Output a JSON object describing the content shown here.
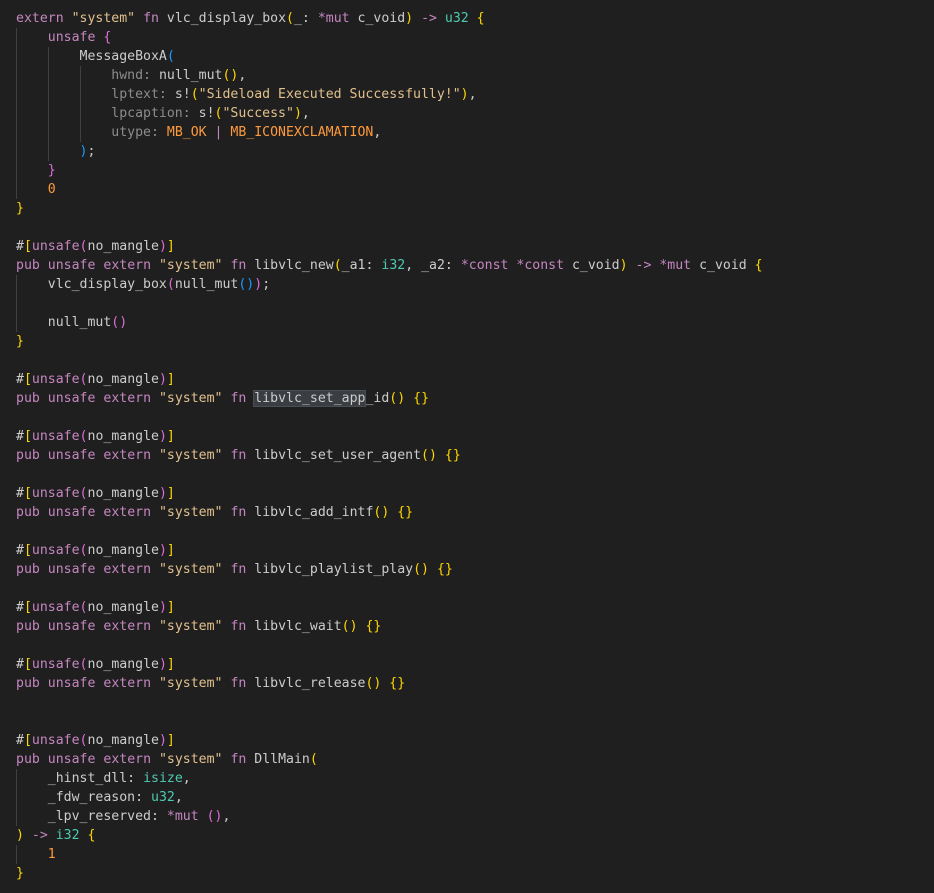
{
  "palette": {
    "background": "#1f1f1f",
    "keyword": "#c586c0",
    "keyword_blue": "#569cd6",
    "string": "#ce9178",
    "string_bright": "#e2c08d",
    "function": "#dcdcaa",
    "type": "#4ec9b0",
    "number": "#b5cea8",
    "plain": "#cccccc",
    "param_hint": "#8c8c8c",
    "bracket_gold": "#ffd700",
    "bracket_pink": "#da70d6",
    "bracket_blue": "#179fff",
    "constant": "#ff9a3c",
    "operator": "#d4d4d4"
  },
  "code_lines": [
    {
      "indent": 0,
      "tokens": [
        {
          "t": "extern",
          "c": "keyword"
        },
        {
          "t": " "
        },
        {
          "t": "\"system\"",
          "c": "string_bright"
        },
        {
          "t": " "
        },
        {
          "t": "fn",
          "c": "keyword"
        },
        {
          "t": " "
        },
        {
          "t": "vlc_display_box",
          "c": "plain"
        },
        {
          "t": "(",
          "c": "bracket_gold"
        },
        {
          "t": "_",
          "c": "plain"
        },
        {
          "t": ": ",
          "c": "plain"
        },
        {
          "t": "*mut",
          "c": "keyword"
        },
        {
          "t": " "
        },
        {
          "t": "c_void",
          "c": "plain"
        },
        {
          "t": ")",
          "c": "bracket_gold"
        },
        {
          "t": " -> ",
          "c": "keyword"
        },
        {
          "t": "u32",
          "c": "type"
        },
        {
          "t": " "
        },
        {
          "t": "{",
          "c": "bracket_gold"
        }
      ]
    },
    {
      "indent": 1,
      "tokens": [
        {
          "t": "unsafe",
          "c": "keyword"
        },
        {
          "t": " "
        },
        {
          "t": "{",
          "c": "bracket_pink"
        }
      ]
    },
    {
      "indent": 2,
      "tokens": [
        {
          "t": "MessageBoxA",
          "c": "plain"
        },
        {
          "t": "(",
          "c": "bracket_blue"
        }
      ]
    },
    {
      "indent": 3,
      "tokens": [
        {
          "t": "hwnd:",
          "c": "param_hint"
        },
        {
          "t": " "
        },
        {
          "t": "null_mut",
          "c": "plain"
        },
        {
          "t": "()",
          "c": "bracket_gold"
        },
        {
          "t": ",",
          "c": "plain"
        }
      ]
    },
    {
      "indent": 3,
      "tokens": [
        {
          "t": "lptext:",
          "c": "param_hint"
        },
        {
          "t": " "
        },
        {
          "t": "s!",
          "c": "plain"
        },
        {
          "t": "(",
          "c": "bracket_gold"
        },
        {
          "t": "\"Sideload Executed Successfully!\"",
          "c": "string_bright"
        },
        {
          "t": ")",
          "c": "bracket_gold"
        },
        {
          "t": ",",
          "c": "plain"
        }
      ]
    },
    {
      "indent": 3,
      "tokens": [
        {
          "t": "lpcaption:",
          "c": "param_hint"
        },
        {
          "t": " "
        },
        {
          "t": "s!",
          "c": "plain"
        },
        {
          "t": "(",
          "c": "bracket_gold"
        },
        {
          "t": "\"Success\"",
          "c": "string_bright"
        },
        {
          "t": ")",
          "c": "bracket_gold"
        },
        {
          "t": ",",
          "c": "plain"
        }
      ]
    },
    {
      "indent": 3,
      "tokens": [
        {
          "t": "utype:",
          "c": "param_hint"
        },
        {
          "t": " "
        },
        {
          "t": "MB_OK",
          "c": "constant"
        },
        {
          "t": " | ",
          "c": "keyword"
        },
        {
          "t": "MB_ICONEXCLAMATION",
          "c": "constant"
        },
        {
          "t": ",",
          "c": "plain"
        }
      ]
    },
    {
      "indent": 2,
      "tokens": [
        {
          "t": ")",
          "c": "bracket_blue"
        },
        {
          "t": ";",
          "c": "plain"
        }
      ]
    },
    {
      "indent": 1,
      "tokens": [
        {
          "t": "}",
          "c": "bracket_pink"
        }
      ]
    },
    {
      "indent": 1,
      "tokens": [
        {
          "t": "0",
          "c": "constant"
        }
      ]
    },
    {
      "indent": 0,
      "tokens": [
        {
          "t": "}",
          "c": "bracket_gold"
        }
      ]
    },
    {
      "indent": 0,
      "tokens": []
    },
    {
      "indent": 0,
      "tokens": [
        {
          "t": "#",
          "c": "plain"
        },
        {
          "t": "[",
          "c": "bracket_gold"
        },
        {
          "t": "unsafe",
          "c": "keyword"
        },
        {
          "t": "(",
          "c": "bracket_pink"
        },
        {
          "t": "no_mangle",
          "c": "plain"
        },
        {
          "t": ")",
          "c": "bracket_pink"
        },
        {
          "t": "]",
          "c": "bracket_gold"
        }
      ]
    },
    {
      "indent": 0,
      "tokens": [
        {
          "t": "pub",
          "c": "keyword"
        },
        {
          "t": " "
        },
        {
          "t": "unsafe",
          "c": "keyword"
        },
        {
          "t": " "
        },
        {
          "t": "extern",
          "c": "keyword"
        },
        {
          "t": " "
        },
        {
          "t": "\"system\"",
          "c": "string_bright"
        },
        {
          "t": " "
        },
        {
          "t": "fn",
          "c": "keyword"
        },
        {
          "t": " "
        },
        {
          "t": "libvlc_new",
          "c": "plain"
        },
        {
          "t": "(",
          "c": "bracket_gold"
        },
        {
          "t": "_a1",
          "c": "plain"
        },
        {
          "t": ": ",
          "c": "plain"
        },
        {
          "t": "i32",
          "c": "type"
        },
        {
          "t": ", ",
          "c": "plain"
        },
        {
          "t": "_a2",
          "c": "plain"
        },
        {
          "t": ": ",
          "c": "plain"
        },
        {
          "t": "*const *const",
          "c": "keyword"
        },
        {
          "t": " "
        },
        {
          "t": "c_void",
          "c": "plain"
        },
        {
          "t": ")",
          "c": "bracket_gold"
        },
        {
          "t": " -> ",
          "c": "keyword"
        },
        {
          "t": "*mut",
          "c": "keyword"
        },
        {
          "t": " "
        },
        {
          "t": "c_void",
          "c": "plain"
        },
        {
          "t": " "
        },
        {
          "t": "{",
          "c": "bracket_gold"
        }
      ]
    },
    {
      "indent": 1,
      "tokens": [
        {
          "t": "vlc_display_box",
          "c": "plain"
        },
        {
          "t": "(",
          "c": "bracket_pink"
        },
        {
          "t": "null_mut",
          "c": "plain"
        },
        {
          "t": "()",
          "c": "bracket_blue"
        },
        {
          "t": ")",
          "c": "bracket_pink"
        },
        {
          "t": ";",
          "c": "plain"
        }
      ]
    },
    {
      "indent": 1,
      "tokens": []
    },
    {
      "indent": 1,
      "tokens": [
        {
          "t": "null_mut",
          "c": "plain"
        },
        {
          "t": "()",
          "c": "bracket_pink"
        }
      ]
    },
    {
      "indent": 0,
      "tokens": [
        {
          "t": "}",
          "c": "bracket_gold"
        }
      ]
    },
    {
      "indent": 0,
      "tokens": []
    },
    {
      "indent": 0,
      "tokens": [
        {
          "t": "#",
          "c": "plain"
        },
        {
          "t": "[",
          "c": "bracket_gold"
        },
        {
          "t": "unsafe",
          "c": "keyword"
        },
        {
          "t": "(",
          "c": "bracket_pink"
        },
        {
          "t": "no_mangle",
          "c": "plain"
        },
        {
          "t": ")",
          "c": "bracket_pink"
        },
        {
          "t": "]",
          "c": "bracket_gold"
        }
      ]
    },
    {
      "indent": 0,
      "tokens": [
        {
          "t": "pub",
          "c": "keyword"
        },
        {
          "t": " "
        },
        {
          "t": "unsafe",
          "c": "keyword"
        },
        {
          "t": " "
        },
        {
          "t": "extern",
          "c": "keyword"
        },
        {
          "t": " "
        },
        {
          "t": "\"system\"",
          "c": "string_bright"
        },
        {
          "t": " "
        },
        {
          "t": "fn",
          "c": "keyword"
        },
        {
          "t": " "
        },
        {
          "t": "libvlc_set_app",
          "c": "plain",
          "hl": true
        },
        {
          "t": "_id",
          "c": "plain"
        },
        {
          "t": "()",
          "c": "bracket_gold"
        },
        {
          "t": " "
        },
        {
          "t": "{}",
          "c": "bracket_gold"
        }
      ]
    },
    {
      "indent": 0,
      "tokens": []
    },
    {
      "indent": 0,
      "tokens": [
        {
          "t": "#",
          "c": "plain"
        },
        {
          "t": "[",
          "c": "bracket_gold"
        },
        {
          "t": "unsafe",
          "c": "keyword"
        },
        {
          "t": "(",
          "c": "bracket_pink"
        },
        {
          "t": "no_mangle",
          "c": "plain"
        },
        {
          "t": ")",
          "c": "bracket_pink"
        },
        {
          "t": "]",
          "c": "bracket_gold"
        }
      ]
    },
    {
      "indent": 0,
      "tokens": [
        {
          "t": "pub",
          "c": "keyword"
        },
        {
          "t": " "
        },
        {
          "t": "unsafe",
          "c": "keyword"
        },
        {
          "t": " "
        },
        {
          "t": "extern",
          "c": "keyword"
        },
        {
          "t": " "
        },
        {
          "t": "\"system\"",
          "c": "string_bright"
        },
        {
          "t": " "
        },
        {
          "t": "fn",
          "c": "keyword"
        },
        {
          "t": " "
        },
        {
          "t": "libvlc_set_user_agent",
          "c": "plain"
        },
        {
          "t": "()",
          "c": "bracket_gold"
        },
        {
          "t": " "
        },
        {
          "t": "{}",
          "c": "bracket_gold"
        }
      ]
    },
    {
      "indent": 0,
      "tokens": []
    },
    {
      "indent": 0,
      "tokens": [
        {
          "t": "#",
          "c": "plain"
        },
        {
          "t": "[",
          "c": "bracket_gold"
        },
        {
          "t": "unsafe",
          "c": "keyword"
        },
        {
          "t": "(",
          "c": "bracket_pink"
        },
        {
          "t": "no_mangle",
          "c": "plain"
        },
        {
          "t": ")",
          "c": "bracket_pink"
        },
        {
          "t": "]",
          "c": "bracket_gold"
        }
      ]
    },
    {
      "indent": 0,
      "tokens": [
        {
          "t": "pub",
          "c": "keyword"
        },
        {
          "t": " "
        },
        {
          "t": "unsafe",
          "c": "keyword"
        },
        {
          "t": " "
        },
        {
          "t": "extern",
          "c": "keyword"
        },
        {
          "t": " "
        },
        {
          "t": "\"system\"",
          "c": "string_bright"
        },
        {
          "t": " "
        },
        {
          "t": "fn",
          "c": "keyword"
        },
        {
          "t": " "
        },
        {
          "t": "libvlc_add_intf",
          "c": "plain"
        },
        {
          "t": "()",
          "c": "bracket_gold"
        },
        {
          "t": " "
        },
        {
          "t": "{}",
          "c": "bracket_gold"
        }
      ]
    },
    {
      "indent": 0,
      "tokens": []
    },
    {
      "indent": 0,
      "tokens": [
        {
          "t": "#",
          "c": "plain"
        },
        {
          "t": "[",
          "c": "bracket_gold"
        },
        {
          "t": "unsafe",
          "c": "keyword"
        },
        {
          "t": "(",
          "c": "bracket_pink"
        },
        {
          "t": "no_mangle",
          "c": "plain"
        },
        {
          "t": ")",
          "c": "bracket_pink"
        },
        {
          "t": "]",
          "c": "bracket_gold"
        }
      ]
    },
    {
      "indent": 0,
      "tokens": [
        {
          "t": "pub",
          "c": "keyword"
        },
        {
          "t": " "
        },
        {
          "t": "unsafe",
          "c": "keyword"
        },
        {
          "t": " "
        },
        {
          "t": "extern",
          "c": "keyword"
        },
        {
          "t": " "
        },
        {
          "t": "\"system\"",
          "c": "string_bright"
        },
        {
          "t": " "
        },
        {
          "t": "fn",
          "c": "keyword"
        },
        {
          "t": " "
        },
        {
          "t": "libvlc_playlist_play",
          "c": "plain"
        },
        {
          "t": "()",
          "c": "bracket_gold"
        },
        {
          "t": " "
        },
        {
          "t": "{}",
          "c": "bracket_gold"
        }
      ]
    },
    {
      "indent": 0,
      "tokens": []
    },
    {
      "indent": 0,
      "tokens": [
        {
          "t": "#",
          "c": "plain"
        },
        {
          "t": "[",
          "c": "bracket_gold"
        },
        {
          "t": "unsafe",
          "c": "keyword"
        },
        {
          "t": "(",
          "c": "bracket_pink"
        },
        {
          "t": "no_mangle",
          "c": "plain"
        },
        {
          "t": ")",
          "c": "bracket_pink"
        },
        {
          "t": "]",
          "c": "bracket_gold"
        }
      ]
    },
    {
      "indent": 0,
      "tokens": [
        {
          "t": "pub",
          "c": "keyword"
        },
        {
          "t": " "
        },
        {
          "t": "unsafe",
          "c": "keyword"
        },
        {
          "t": " "
        },
        {
          "t": "extern",
          "c": "keyword"
        },
        {
          "t": " "
        },
        {
          "t": "\"system\"",
          "c": "string_bright"
        },
        {
          "t": " "
        },
        {
          "t": "fn",
          "c": "keyword"
        },
        {
          "t": " "
        },
        {
          "t": "libvlc_wait",
          "c": "plain"
        },
        {
          "t": "()",
          "c": "bracket_gold"
        },
        {
          "t": " "
        },
        {
          "t": "{}",
          "c": "bracket_gold"
        }
      ]
    },
    {
      "indent": 0,
      "tokens": []
    },
    {
      "indent": 0,
      "tokens": [
        {
          "t": "#",
          "c": "plain"
        },
        {
          "t": "[",
          "c": "bracket_gold"
        },
        {
          "t": "unsafe",
          "c": "keyword"
        },
        {
          "t": "(",
          "c": "bracket_pink"
        },
        {
          "t": "no_mangle",
          "c": "plain"
        },
        {
          "t": ")",
          "c": "bracket_pink"
        },
        {
          "t": "]",
          "c": "bracket_gold"
        }
      ]
    },
    {
      "indent": 0,
      "tokens": [
        {
          "t": "pub",
          "c": "keyword"
        },
        {
          "t": " "
        },
        {
          "t": "unsafe",
          "c": "keyword"
        },
        {
          "t": " "
        },
        {
          "t": "extern",
          "c": "keyword"
        },
        {
          "t": " "
        },
        {
          "t": "\"system\"",
          "c": "string_bright"
        },
        {
          "t": " "
        },
        {
          "t": "fn",
          "c": "keyword"
        },
        {
          "t": " "
        },
        {
          "t": "libvlc_release",
          "c": "plain"
        },
        {
          "t": "()",
          "c": "bracket_gold"
        },
        {
          "t": " "
        },
        {
          "t": "{}",
          "c": "bracket_gold"
        }
      ]
    },
    {
      "indent": 0,
      "tokens": []
    },
    {
      "indent": 0,
      "tokens": []
    },
    {
      "indent": 0,
      "tokens": [
        {
          "t": "#",
          "c": "plain"
        },
        {
          "t": "[",
          "c": "bracket_gold"
        },
        {
          "t": "unsafe",
          "c": "keyword"
        },
        {
          "t": "(",
          "c": "bracket_pink"
        },
        {
          "t": "no_mangle",
          "c": "plain"
        },
        {
          "t": ")",
          "c": "bracket_pink"
        },
        {
          "t": "]",
          "c": "bracket_gold"
        }
      ]
    },
    {
      "indent": 0,
      "tokens": [
        {
          "t": "pub",
          "c": "keyword"
        },
        {
          "t": " "
        },
        {
          "t": "unsafe",
          "c": "keyword"
        },
        {
          "t": " "
        },
        {
          "t": "extern",
          "c": "keyword"
        },
        {
          "t": " "
        },
        {
          "t": "\"system\"",
          "c": "string_bright"
        },
        {
          "t": " "
        },
        {
          "t": "fn",
          "c": "keyword"
        },
        {
          "t": " "
        },
        {
          "t": "DllMain",
          "c": "plain"
        },
        {
          "t": "(",
          "c": "bracket_gold"
        }
      ]
    },
    {
      "indent": 1,
      "tokens": [
        {
          "t": "_hinst_dll",
          "c": "plain"
        },
        {
          "t": ": ",
          "c": "plain"
        },
        {
          "t": "isize",
          "c": "type"
        },
        {
          "t": ",",
          "c": "plain"
        }
      ]
    },
    {
      "indent": 1,
      "tokens": [
        {
          "t": "_fdw_reason",
          "c": "plain"
        },
        {
          "t": ": ",
          "c": "plain"
        },
        {
          "t": "u32",
          "c": "type"
        },
        {
          "t": ",",
          "c": "plain"
        }
      ]
    },
    {
      "indent": 1,
      "tokens": [
        {
          "t": "_lpv_reserved",
          "c": "plain"
        },
        {
          "t": ": ",
          "c": "plain"
        },
        {
          "t": "*mut",
          "c": "keyword"
        },
        {
          "t": " "
        },
        {
          "t": "()",
          "c": "bracket_pink"
        },
        {
          "t": ",",
          "c": "plain"
        }
      ]
    },
    {
      "indent": 0,
      "tokens": [
        {
          "t": ")",
          "c": "bracket_gold"
        },
        {
          "t": " -> ",
          "c": "keyword"
        },
        {
          "t": "i32",
          "c": "type"
        },
        {
          "t": " "
        },
        {
          "t": "{",
          "c": "bracket_gold"
        }
      ]
    },
    {
      "indent": 1,
      "tokens": [
        {
          "t": "1",
          "c": "constant"
        }
      ]
    },
    {
      "indent": 0,
      "tokens": [
        {
          "t": "}",
          "c": "bracket_gold"
        }
      ]
    }
  ]
}
